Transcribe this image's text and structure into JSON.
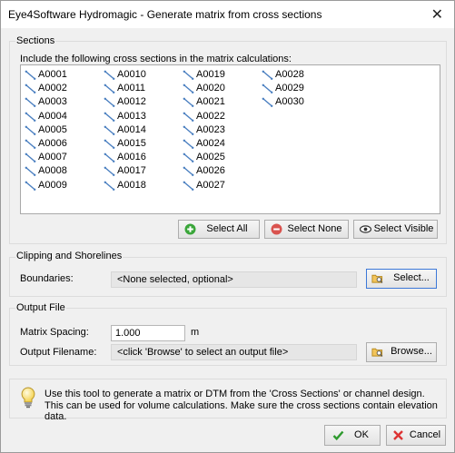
{
  "window": {
    "title": "Eye4Software Hydromagic - Generate matrix from cross sections"
  },
  "sections": {
    "label": "Sections",
    "instruction": "Include the following cross sections in the matrix calculations:",
    "items": [
      "A0001",
      "A0002",
      "A0003",
      "A0004",
      "A0005",
      "A0006",
      "A0007",
      "A0008",
      "A0009",
      "A0010",
      "A0011",
      "A0012",
      "A0013",
      "A0014",
      "A0015",
      "A0016",
      "A0017",
      "A0018",
      "A0019",
      "A0020",
      "A0021",
      "A0022",
      "A0023",
      "A0024",
      "A0025",
      "A0026",
      "A0027",
      "A0028",
      "A0029",
      "A0030"
    ],
    "buttons": {
      "select_all": "Select All",
      "select_none": "Select None",
      "select_visible": "Select Visible"
    }
  },
  "clipping": {
    "label": "Clipping and Shorelines",
    "boundaries_label": "Boundaries:",
    "boundaries_value": "<None selected, optional>",
    "select_button": "Select..."
  },
  "output": {
    "label": "Output File",
    "spacing_label": "Matrix Spacing:",
    "spacing_value": "1.000",
    "spacing_unit": "m",
    "filename_label": "Output Filename:",
    "filename_value": "<click 'Browse' to select an output file>",
    "browse_button": "Browse..."
  },
  "info": {
    "line1": "Use this tool to generate a matrix or DTM from the 'Cross Sections' or channel design.",
    "line2": "This can be used for volume calculations. Make sure the cross sections contain elevation data."
  },
  "footer": {
    "ok": "OK",
    "cancel": "Cancel"
  },
  "colors": {
    "accent": "#3c78d8",
    "select_all_icon": "#3aa63a",
    "select_none_icon": "#d9534f"
  }
}
